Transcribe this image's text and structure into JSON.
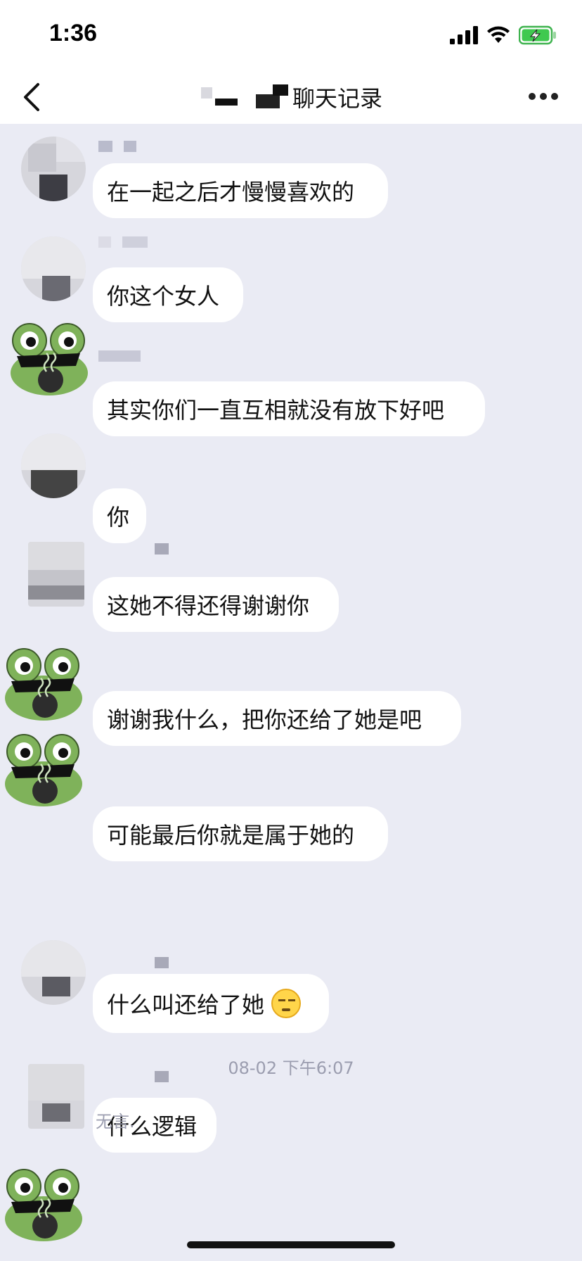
{
  "status_bar": {
    "time": "1:36"
  },
  "nav": {
    "title": "聊天记录"
  },
  "messages": [
    {
      "text": "在一起之后才慢慢喜欢的",
      "sender": "blurred"
    },
    {
      "text": "你这个女人",
      "sender": "blurred"
    },
    {
      "text": "其实你们一直互相就没有放下好吧",
      "sender": "frog"
    },
    {
      "text": "你",
      "sender": "blurred"
    },
    {
      "text": "这她不得还得谢谢你",
      "sender": "blurred"
    },
    {
      "text": "谢谢我什么，把你还给了她是吧",
      "sender": "frog"
    },
    {
      "text": "可能最后你就是属于她的",
      "sender": "frog"
    },
    {
      "text": "什么叫还给了她",
      "sender": "blurred",
      "emoji": "sweat-face-emoji"
    },
    {
      "text": "什么逻辑",
      "sender": "blurred"
    }
  ],
  "timestamp": "08-02 下午6:07",
  "partial_message": "无言."
}
